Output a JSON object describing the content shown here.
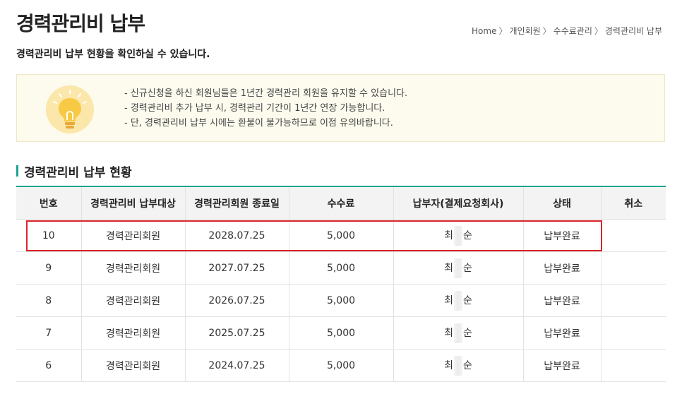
{
  "header": {
    "title": "경력관리비 납부",
    "subtitle": "경력관리비 납부 현황을 확인하실 수 있습니다.",
    "breadcrumb": [
      "Home",
      "개인회원",
      "수수료관리",
      "경력관리비 납부"
    ]
  },
  "notice": {
    "icon": "lightbulb-icon",
    "lines": [
      "- 신규신청을 하신 회원님들은 1년간 경력관리 회원을 유지할 수 있습니다.",
      "- 경력관리비 추가 납부 시, 경력관리 기간이 1년간 연장 가능합니다.",
      "- 단, 경력관리비 납부 시에는 환불이 불가능하므로 이점 유의바랍니다."
    ]
  },
  "section": {
    "title": "경력관리비 납부 현황"
  },
  "table": {
    "columns": [
      "번호",
      "경력관리비 납부대상",
      "경력관리회원 종료일",
      "수수료",
      "납부자(결제요청회사)",
      "상태",
      "취소"
    ],
    "rows": [
      {
        "no": "10",
        "target": "경력관리회원",
        "end_date": "2028.07.25",
        "fee": "5,000",
        "payer_first": "최",
        "payer_last": "순",
        "status": "납부완료",
        "cancel": ""
      },
      {
        "no": "9",
        "target": "경력관리회원",
        "end_date": "2027.07.25",
        "fee": "5,000",
        "payer_first": "최",
        "payer_last": "순",
        "status": "납부완료",
        "cancel": ""
      },
      {
        "no": "8",
        "target": "경력관리회원",
        "end_date": "2026.07.25",
        "fee": "5,000",
        "payer_first": "최",
        "payer_last": "순",
        "status": "납부완료",
        "cancel": ""
      },
      {
        "no": "7",
        "target": "경력관리회원",
        "end_date": "2025.07.25",
        "fee": "5,000",
        "payer_first": "최",
        "payer_last": "순",
        "status": "납부완료",
        "cancel": ""
      },
      {
        "no": "6",
        "target": "경력관리회원",
        "end_date": "2024.07.25",
        "fee": "5,000",
        "payer_first": "최",
        "payer_last": "순",
        "status": "납부완료",
        "cancel": ""
      }
    ]
  },
  "colors": {
    "accent": "#1aa58f",
    "highlight": "#d9242a",
    "notice_bg": "#fdfbee",
    "bulb": "#f8c944"
  }
}
